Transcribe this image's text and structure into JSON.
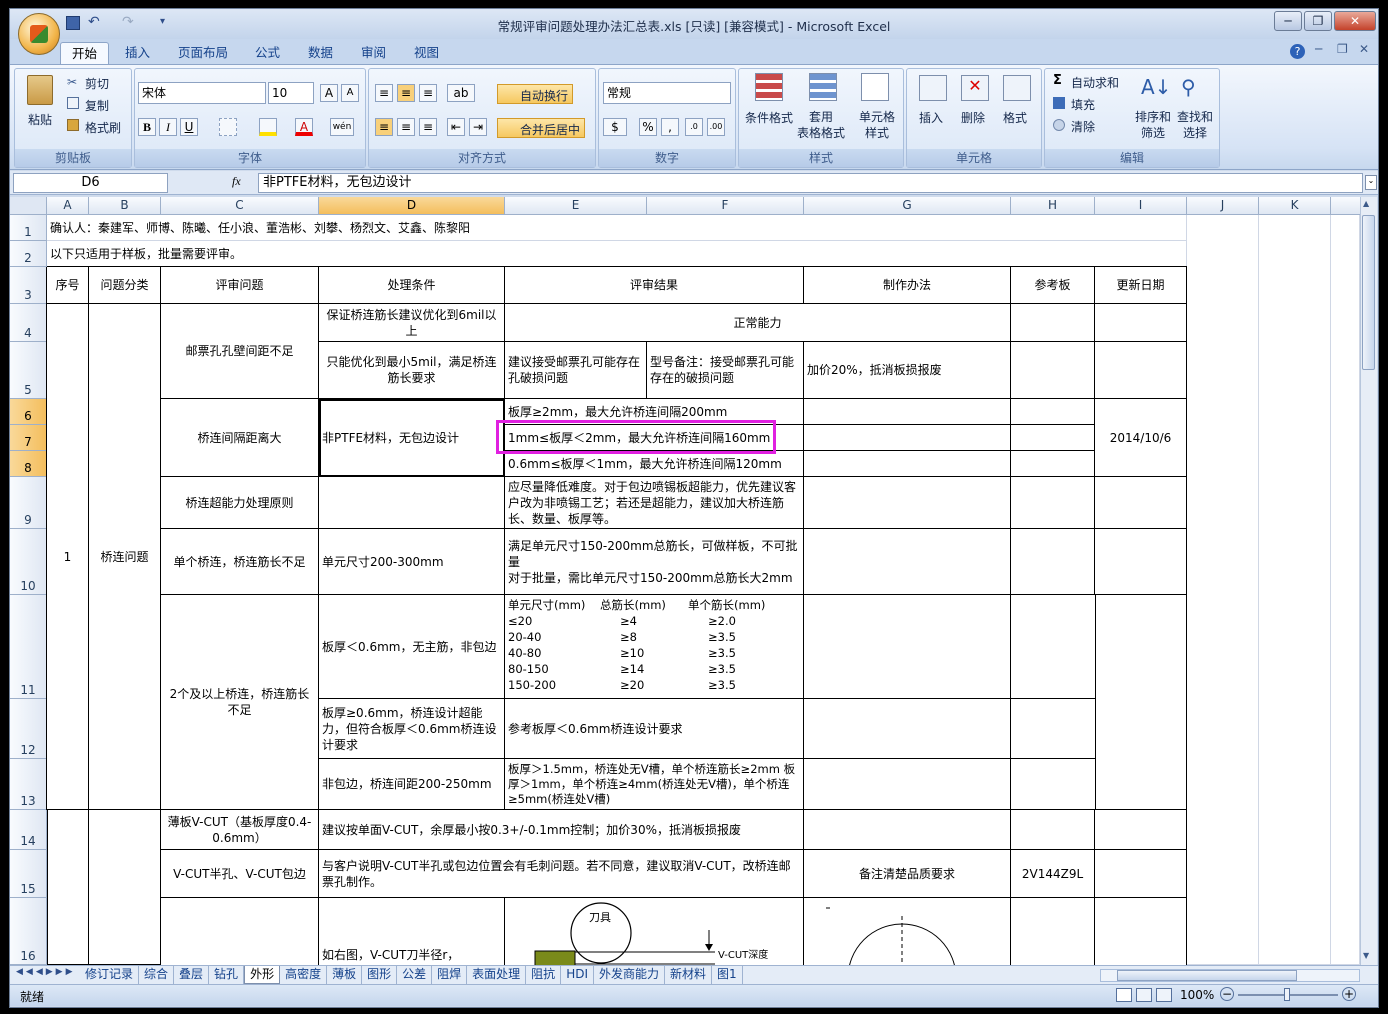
{
  "window": {
    "title": "常规评审问题处理办法汇总表.xls [只读] [兼容模式] - Microsoft Excel",
    "minimize": "─",
    "restore": "❐",
    "close": "✕"
  },
  "ribbon_tabs": [
    "开始",
    "插入",
    "页面布局",
    "公式",
    "数据",
    "审阅",
    "视图"
  ],
  "ribbon": {
    "clipboard": {
      "label": "剪贴板",
      "paste": "粘贴",
      "cut": "剪切",
      "copy": "复制",
      "format_painter": "格式刷"
    },
    "font": {
      "label": "字体",
      "font_name": "宋体",
      "font_size": "10",
      "bold": "B",
      "italic": "I",
      "underline": "U",
      "grow": "A",
      "shrink": "A",
      "wen": "wén"
    },
    "alignment": {
      "label": "对齐方式",
      "wrap": "自动换行",
      "merge": "合并后居中"
    },
    "number": {
      "label": "数字",
      "format": "常规",
      "percent": "%",
      "comma": ","
    },
    "styles": {
      "label": "样式",
      "cond_format": "条件格式",
      "table_format": "套用\n表格格式",
      "cell_style": "单元格\n样式"
    },
    "cells": {
      "label": "单元格",
      "insert": "插入",
      "delete": "删除",
      "format": "格式"
    },
    "editing": {
      "label": "编辑",
      "autosum": "自动求和",
      "fill": "填充",
      "clear": "清除",
      "sort": "排序和\n筛选",
      "find": "查找和\n选择"
    },
    "icons": {
      "sigma": "Σ",
      "help": "?"
    }
  },
  "formula_bar": {
    "name_box": "D6",
    "fx": "fx",
    "value": "非PTFE材料，无包边设计"
  },
  "columns": [
    "A",
    "B",
    "C",
    "D",
    "E",
    "F",
    "G",
    "H",
    "I",
    "J",
    "K"
  ],
  "rows": [
    "1",
    "2",
    "3",
    "4",
    "5",
    "6",
    "7",
    "8",
    "9",
    "10",
    "11",
    "12",
    "13",
    "14",
    "15",
    "16"
  ],
  "cells": {
    "r1": "确认人：秦建军、师博、陈曦、任小浪、董浩彬、刘攀、杨烈文、艾鑫、陈黎阳",
    "r2": "以下只适用于样板，批量需要评审。",
    "h_a": "序号",
    "h_b": "问题分类",
    "h_c": "评审问题",
    "h_d": "处理条件",
    "h_e": "评审结果",
    "h_g": "制作办法",
    "h_h": "参考板",
    "h_i": "更新日期",
    "a_num": "1",
    "b_cat": "桥连问题",
    "c4": "邮票孔孔壁间距不足",
    "d4": "保证桥连筋长建议优化到6mil以上",
    "e4": "正常能力",
    "d5": "只能优化到最小5mil，满足桥连筋长要求",
    "e5": "建议接受邮票孔可能存在孔破损问题",
    "f5": "型号备注：接受邮票孔可能存在的破损问题",
    "g5": "加价20%，抵消板损报废",
    "c6": "桥连间隔距离大",
    "d6": "非PTFE材料，无包边设计",
    "e6": "板厚≥2mm，最大允许桥连间隔200mm",
    "e7": "1mm≤板厚＜2mm，最大允许桥连间隔160mm",
    "e8": "0.6mm≤板厚＜1mm，最大允许桥连间隔120mm",
    "i7": "2014/10/6",
    "c9": "桥连超能力处理原则",
    "e9": "应尽量降低难度。对于包边喷锡板超能力，优先建议客户改为非喷锡工艺；若还是超能力，建议加大桥连筋长、数量、板厚等。",
    "c10": "单个桥连，桥连筋长不足",
    "d10": "单元尺寸200-300mm",
    "e10_l1": "满足单元尺寸150-200mm总筋长，可做样板，不可批量",
    "e10_l2": "对于批量，需比单元尺寸150-200mm总筋长大2mm",
    "c11": "2个及以上桥连，桥连筋长不足",
    "d11": "板厚＜0.6mm，无主筋，非包边",
    "e11_table": [
      [
        "单元尺寸(mm)",
        "总筋长(mm)",
        "单个筋长(mm)"
      ],
      [
        "≤20",
        "≥4",
        "≥2.0"
      ],
      [
        "20-40",
        "≥8",
        "≥3.5"
      ],
      [
        "40-80",
        "≥10",
        "≥3.5"
      ],
      [
        "80-150",
        "≥14",
        "≥3.5"
      ],
      [
        "150-200",
        "≥20",
        "≥3.5"
      ]
    ],
    "d12": "板厚≥0.6mm，桥连设计超能力，但符合板厚＜0.6mm桥连设计要求",
    "e12": "参考板厚＜0.6mm桥连设计要求",
    "d13": "非包边，桥连间距200-250mm",
    "e13": "板厚＞1.5mm，桥连处无V槽，单个桥连筋长≥2mm 板厚＞1mm，单个桥连≥4mm(桥连处无V槽)，单个桥连≥5mm(桥连处V槽)",
    "c14": "薄板V-CUT（基板厚度0.4-0.6mm）",
    "d14": "建议按单面V-CUT，余厚最小按0.3+/-0.1mm控制；加价30%，抵消板损报废",
    "c15": "V-CUT半孔、V-CUT包边",
    "d15": "与客户说明V-CUT半孔或包边位置会有毛刺问题。若不同意，建议取消V-CUT，改桥连邮票孔制作。",
    "g15": "备注清楚品质要求",
    "h15": "2V144Z9L",
    "d16": "如右图，V-CUT刀半径r，",
    "fig_tool": "刀具",
    "fig_vcut": "V-CUT深度"
  },
  "sheet_tabs": [
    "修订记录",
    "综合",
    "叠层",
    "钻孔",
    "外形",
    "高密度",
    "薄板",
    "图形",
    "公差",
    "阻焊",
    "表面处理",
    "阻抗",
    "HDI",
    "外发商能力",
    "新材料",
    "图1"
  ],
  "active_sheet": "外形",
  "status": {
    "ready": "就绪",
    "zoom": "100%"
  },
  "colors": {
    "highlight": "#e020e0",
    "selected_header": "#f4be5d"
  }
}
